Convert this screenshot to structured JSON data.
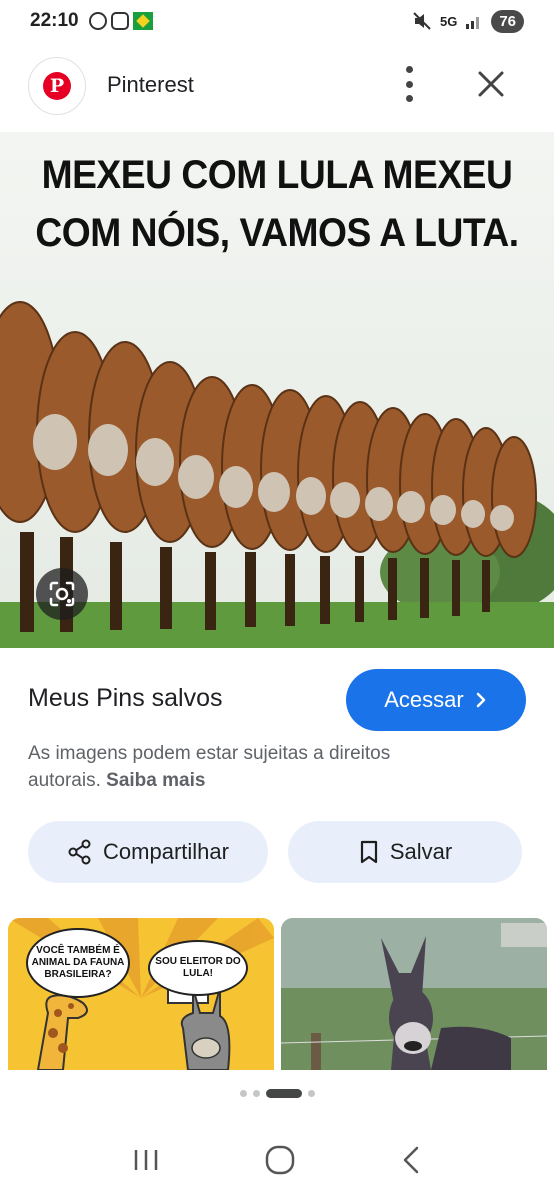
{
  "status_bar": {
    "time": "22:10",
    "network": "5G",
    "battery": "76",
    "icons": [
      "whatsapp-icon",
      "instagram-icon",
      "flag-icon",
      "mute-icon",
      "signal-icon"
    ]
  },
  "header": {
    "site_name": "Pinterest",
    "logo_letter": "P",
    "logo_color": "#e60023"
  },
  "image": {
    "caption_line1": "MEXEU COM LULA MEXEU",
    "caption_line2": "COM NÓIS, VAMOS A LUTA."
  },
  "info": {
    "title": "Meus Pins salvos",
    "access_label": "Acessar",
    "copyright_text": "As imagens podem estar sujeitas a direitos autorais.",
    "learn_more": "Saiba mais"
  },
  "actions": {
    "share_label": "Compartilhar",
    "save_label": "Salvar"
  },
  "related": {
    "item1_bubble1": "VOCÊ TAMBÉM É ANIMAL DA FAUNA BRASILEIRA?",
    "item1_bubble2": "SOU ELEITOR DO LULA!"
  },
  "colors": {
    "accent": "#1a73e8",
    "action_bg": "#e8effa",
    "pinterest_red": "#e60023"
  }
}
